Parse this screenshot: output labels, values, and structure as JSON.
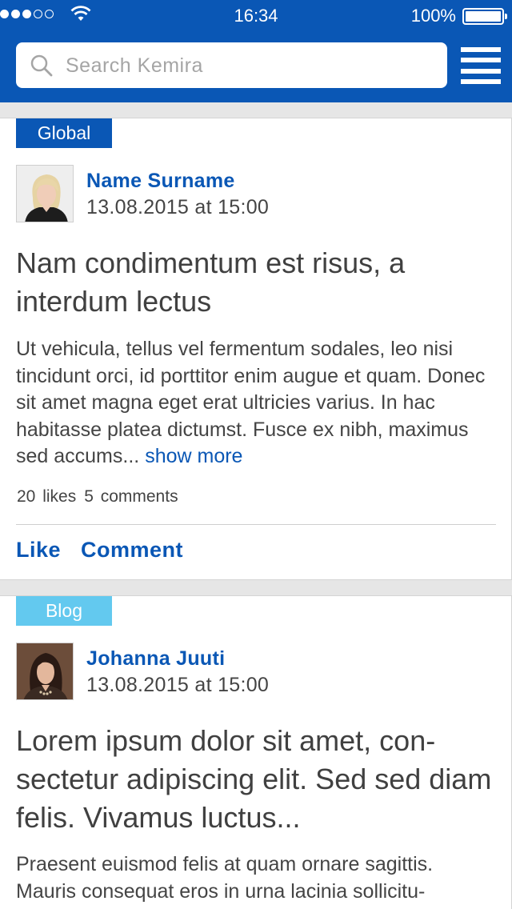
{
  "status_bar": {
    "time": "16:34",
    "battery": "100%"
  },
  "search": {
    "placeholder": "Search Kemira"
  },
  "posts": [
    {
      "tag": "Global",
      "author": "Name Surname",
      "date": "13.08.2015 at 15:00",
      "title": "Nam condimentum est risus, a interdum lectus",
      "excerpt": "Ut vehicula, tellus vel fermentum sodales, leo nisi tincidunt orci, id porttitor enim augue et quam. Donec sit amet magna eget erat ultricies varius. In hac habitasse platea dictumst. Fusce ex nibh, maximus sed accums...",
      "show_more": "show more",
      "likes": "20 likes",
      "comments": "5 comments",
      "like_label": "Like",
      "comment_label": "Comment"
    },
    {
      "tag": "Blog",
      "author": "Johanna Juuti",
      "date": "13.08.2015 at 15:00",
      "title": "Lorem ipsum dolor sit amet, con-sectetur adipiscing elit. Sed sed diam felis. Vivamus luctus...",
      "excerpt": "Praesent euismod felis at quam ornare sagittis. Mauris consequat eros in urna lacinia sollicitu-"
    }
  ],
  "colors": {
    "brand": "#0a57b5",
    "blog_tag": "#63c9ef"
  }
}
